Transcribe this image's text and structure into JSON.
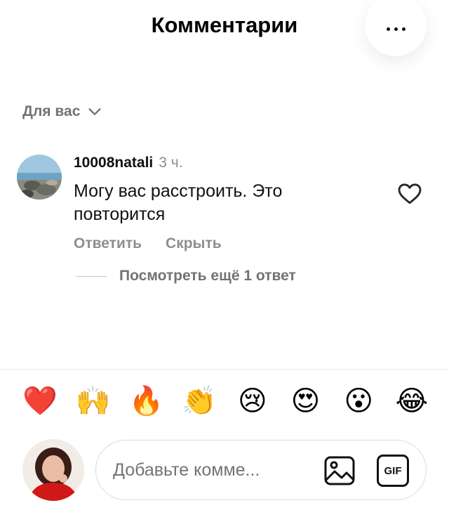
{
  "header": {
    "title": "Комментарии",
    "more_icon": "more-horizontal-icon"
  },
  "sort": {
    "label": "Для вас",
    "icon": "chevron-down-icon"
  },
  "comment": {
    "username": "10008natali",
    "time": "3 ч.",
    "text": "Могу вас расстроить. Это повторится",
    "like_icon": "heart-outline-icon",
    "reply_label": "Ответить",
    "hide_label": "Скрыть",
    "view_replies": "Посмотреть ещё 1 ответ"
  },
  "emojis": [
    "❤️",
    "🙌",
    "🔥",
    "👏",
    "😢",
    "😍",
    "😮",
    "😂"
  ],
  "composer": {
    "placeholder": "Добавьте комме...",
    "image_icon": "image-icon",
    "gif_label": "GIF"
  },
  "colors": {
    "text": "#000000",
    "secondary": "#8e8e8e",
    "border": "#dbdbdb"
  }
}
